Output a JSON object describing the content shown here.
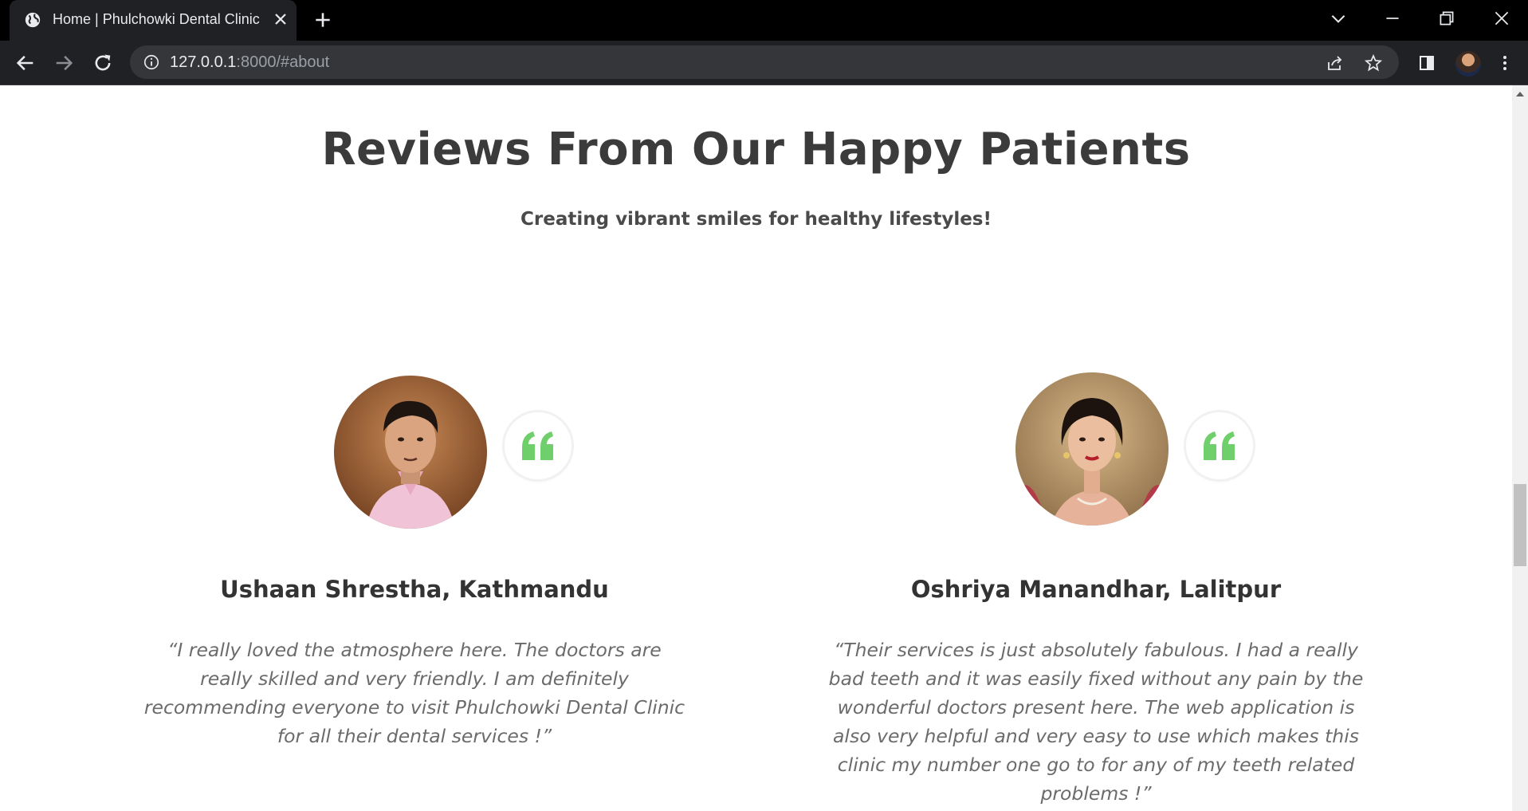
{
  "browser": {
    "tab_title": "Home | Phulchowki Dental Clinic",
    "url_host": "127.0.0.1",
    "url_rest": ":8000/#about"
  },
  "page": {
    "section_title": "Reviews From Our Happy Patients",
    "section_subtitle": "Creating vibrant smiles for healthy lifestyles!",
    "reviews": [
      {
        "name": "Ushaan Shrestha, Kathmandu",
        "text": "“I really loved the atmosphere here. The doctors are really skilled and very friendly. I am definitely recommending everyone to visit Phulchowki Dental Clinic for all their dental services !”",
        "photo": "male-patient-photo"
      },
      {
        "name": "Oshriya Manandhar, Lalitpur",
        "text": "“Their services is just absolutely fabulous. I had a really bad teeth and it was easily fixed without any pain by the wonderful doctors present here. The web application is also very helpful and very easy to use which makes this clinic my number one go to for any of my teeth related problems !”",
        "photo": "female-patient-photo"
      }
    ],
    "quote_color": "#6fcf6a"
  }
}
